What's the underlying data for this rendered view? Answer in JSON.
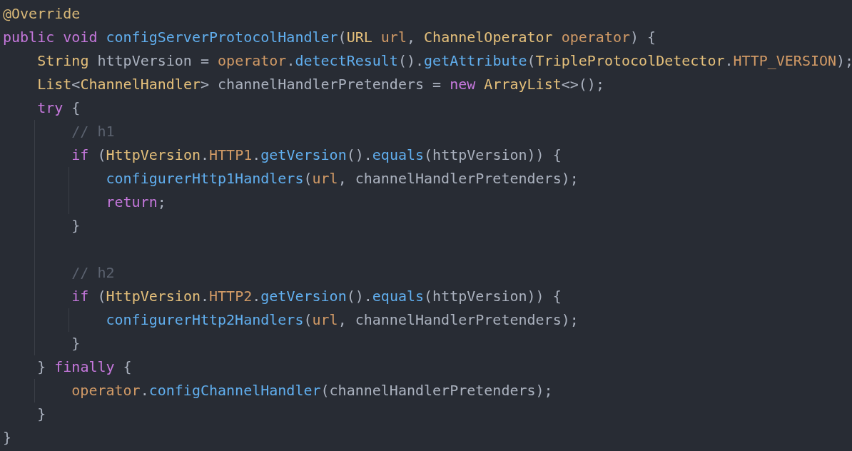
{
  "editor": {
    "sections": [
      {
        "lines": [
          {
            "tokens": [
              {
                "text": "@Override",
                "kind": "annotation"
              }
            ]
          },
          {
            "tokens": [
              {
                "text": "public void ",
                "kind": "keyword"
              },
              {
                "text": "configServerProtocolHandler",
                "kind": "function"
              },
              {
                "text": "(",
                "kind": "plain"
              },
              {
                "text": "URL ",
                "kind": "type"
              },
              {
                "text": "url",
                "kind": "field"
              },
              {
                "text": ", ",
                "kind": "plain"
              },
              {
                "text": "ChannelOperator ",
                "kind": "type"
              },
              {
                "text": "operator",
                "kind": "field"
              },
              {
                "text": ") {",
                "kind": "plain"
              }
            ]
          },
          {
            "tokens": [
              {
                "text": "    String",
                "kind": "type"
              },
              {
                "text": " httpVersion = ",
                "kind": "plain"
              },
              {
                "text": "operator",
                "kind": "field"
              },
              {
                "text": ".",
                "kind": "plain"
              },
              {
                "text": "detectResult",
                "kind": "function"
              },
              {
                "text": "().",
                "kind": "plain"
              },
              {
                "text": "getAttribute",
                "kind": "function"
              },
              {
                "text": "(",
                "kind": "plain"
              },
              {
                "text": "TripleProtocolDetector",
                "kind": "type"
              },
              {
                "text": ".",
                "kind": "plain"
              },
              {
                "text": "HTTP_VERSION",
                "kind": "field"
              },
              {
                "text": ");",
                "kind": "plain"
              }
            ]
          },
          {
            "tokens": [
              {
                "text": "    List",
                "kind": "type"
              },
              {
                "text": "<",
                "kind": "plain"
              },
              {
                "text": "ChannelHandler",
                "kind": "type"
              },
              {
                "text": "> channelHandlerPretenders = ",
                "kind": "plain"
              },
              {
                "text": "new ",
                "kind": "keyword"
              },
              {
                "text": "ArrayList",
                "kind": "type"
              },
              {
                "text": "<>();",
                "kind": "plain"
              }
            ]
          },
          {
            "tokens": [
              {
                "text": "    try",
                "kind": "keyword"
              },
              {
                "text": " {",
                "kind": "plain"
              }
            ]
          },
          {
            "tokens": [
              {
                "text": "        // h1",
                "kind": "comment"
              }
            ]
          },
          {
            "tokens": [
              {
                "text": "        if",
                "kind": "keyword"
              },
              {
                "text": " (",
                "kind": "plain"
              },
              {
                "text": "HttpVersion",
                "kind": "type"
              },
              {
                "text": ".",
                "kind": "plain"
              },
              {
                "text": "HTTP1",
                "kind": "field"
              },
              {
                "text": ".",
                "kind": "plain"
              },
              {
                "text": "getVersion",
                "kind": "function"
              },
              {
                "text": "().",
                "kind": "plain"
              },
              {
                "text": "equals",
                "kind": "function"
              },
              {
                "text": "(httpVersion)) {",
                "kind": "plain"
              }
            ]
          },
          {
            "tokens": [
              {
                "text": "            configurerHttp1Handlers",
                "kind": "function"
              },
              {
                "text": "(",
                "kind": "plain"
              },
              {
                "text": "url",
                "kind": "field"
              },
              {
                "text": ", channelHandlerPretenders);",
                "kind": "plain"
              }
            ]
          },
          {
            "tokens": [
              {
                "text": "            return",
                "kind": "keyword"
              },
              {
                "text": ";",
                "kind": "plain"
              }
            ]
          },
          {
            "tokens": [
              {
                "text": "        }",
                "kind": "plain"
              }
            ]
          }
        ]
      },
      {
        "lines": [
          {
            "tokens": [
              {
                "text": "        // h2",
                "kind": "comment"
              }
            ]
          },
          {
            "tokens": [
              {
                "text": "        if",
                "kind": "keyword"
              },
              {
                "text": " (",
                "kind": "plain"
              },
              {
                "text": "HttpVersion",
                "kind": "type"
              },
              {
                "text": ".",
                "kind": "plain"
              },
              {
                "text": "HTTP2",
                "kind": "field"
              },
              {
                "text": ".",
                "kind": "plain"
              },
              {
                "text": "getVersion",
                "kind": "function"
              },
              {
                "text": "().",
                "kind": "plain"
              },
              {
                "text": "equals",
                "kind": "function"
              },
              {
                "text": "(httpVersion)) {",
                "kind": "plain"
              }
            ]
          },
          {
            "tokens": [
              {
                "text": "            configurerHttp2Handlers",
                "kind": "function"
              },
              {
                "text": "(",
                "kind": "plain"
              },
              {
                "text": "url",
                "kind": "field"
              },
              {
                "text": ", channelHandlerPretenders);",
                "kind": "plain"
              }
            ]
          },
          {
            "tokens": [
              {
                "text": "        }",
                "kind": "plain"
              }
            ]
          },
          {
            "tokens": [
              {
                "text": "    } ",
                "kind": "plain"
              },
              {
                "text": "finally",
                "kind": "keyword"
              },
              {
                "text": " {",
                "kind": "plain"
              }
            ]
          },
          {
            "tokens": [
              {
                "text": "        operator",
                "kind": "field"
              },
              {
                "text": ".",
                "kind": "plain"
              },
              {
                "text": "configChannelHandler",
                "kind": "function"
              },
              {
                "text": "(channelHandlerPretenders);",
                "kind": "plain"
              }
            ]
          },
          {
            "tokens": [
              {
                "text": "    }",
                "kind": "plain"
              }
            ]
          },
          {
            "tokens": [
              {
                "text": "}",
                "kind": "plain"
              }
            ]
          }
        ]
      }
    ]
  }
}
